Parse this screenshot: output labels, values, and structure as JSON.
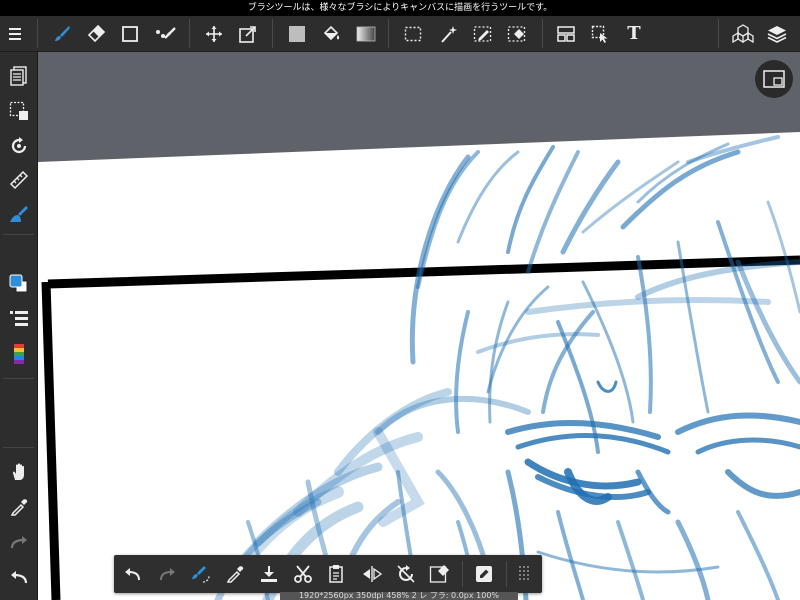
{
  "status_bar": {
    "tooltip": "ブラシツールは、様々なブラシによりキャンバスに描画を行うツールです。"
  },
  "toolbar": {
    "colors": {
      "active": "#2f8fd6",
      "icon": "#e6e6e6"
    },
    "tools": [
      {
        "name": "menu-icon",
        "active": false
      },
      {
        "name": "brush-icon",
        "active": true
      },
      {
        "name": "eraser-icon",
        "active": false
      },
      {
        "name": "shape-icon",
        "active": false
      },
      {
        "name": "dot-tool-icon",
        "active": false
      },
      {
        "name": "move-icon",
        "active": false
      },
      {
        "name": "transform-icon",
        "active": false
      },
      {
        "name": "fill-color-icon",
        "active": false
      },
      {
        "name": "bucket-icon",
        "active": false
      },
      {
        "name": "gradient-icon",
        "active": false
      },
      {
        "name": "select-rect-icon",
        "active": false
      },
      {
        "name": "magic-wand-icon",
        "active": false
      },
      {
        "name": "select-pen-icon",
        "active": false
      },
      {
        "name": "select-eraser-icon",
        "active": false
      },
      {
        "name": "panel-divide-icon",
        "active": false
      },
      {
        "name": "operation-icon",
        "active": false
      },
      {
        "name": "text-icon",
        "active": false
      },
      {
        "name": "materials-icon",
        "active": false
      },
      {
        "name": "layers-icon",
        "active": false
      }
    ],
    "text_tool_glyph": "T"
  },
  "sidebar": {
    "items": [
      "layer-icon",
      "selection-icon",
      "rotate-icon",
      "ruler-icon",
      "pen-settings-icon",
      "color-icon",
      "brush-list-icon",
      "color-palette-icon",
      "hand-icon",
      "eyedropper-icon",
      "redo-icon",
      "undo-icon"
    ]
  },
  "canvas": {
    "page_color": "#ffffff",
    "background_color": "#5f6369",
    "stroke_color": "#1f6fb2"
  },
  "bottom_bar": {
    "items": [
      "undo-icon",
      "redo-icon",
      "quick-brush-icon",
      "eyedropper-icon",
      "import-icon",
      "cut-icon",
      "paste-icon",
      "flip-icon",
      "reset-rotation-icon",
      "clear-selection-icon",
      "edit-icon",
      "grip-icon"
    ]
  },
  "info_strip": {
    "text": "1920*2560px 350dpi 458% 2 レ ブラ: 0.0px 100%"
  }
}
